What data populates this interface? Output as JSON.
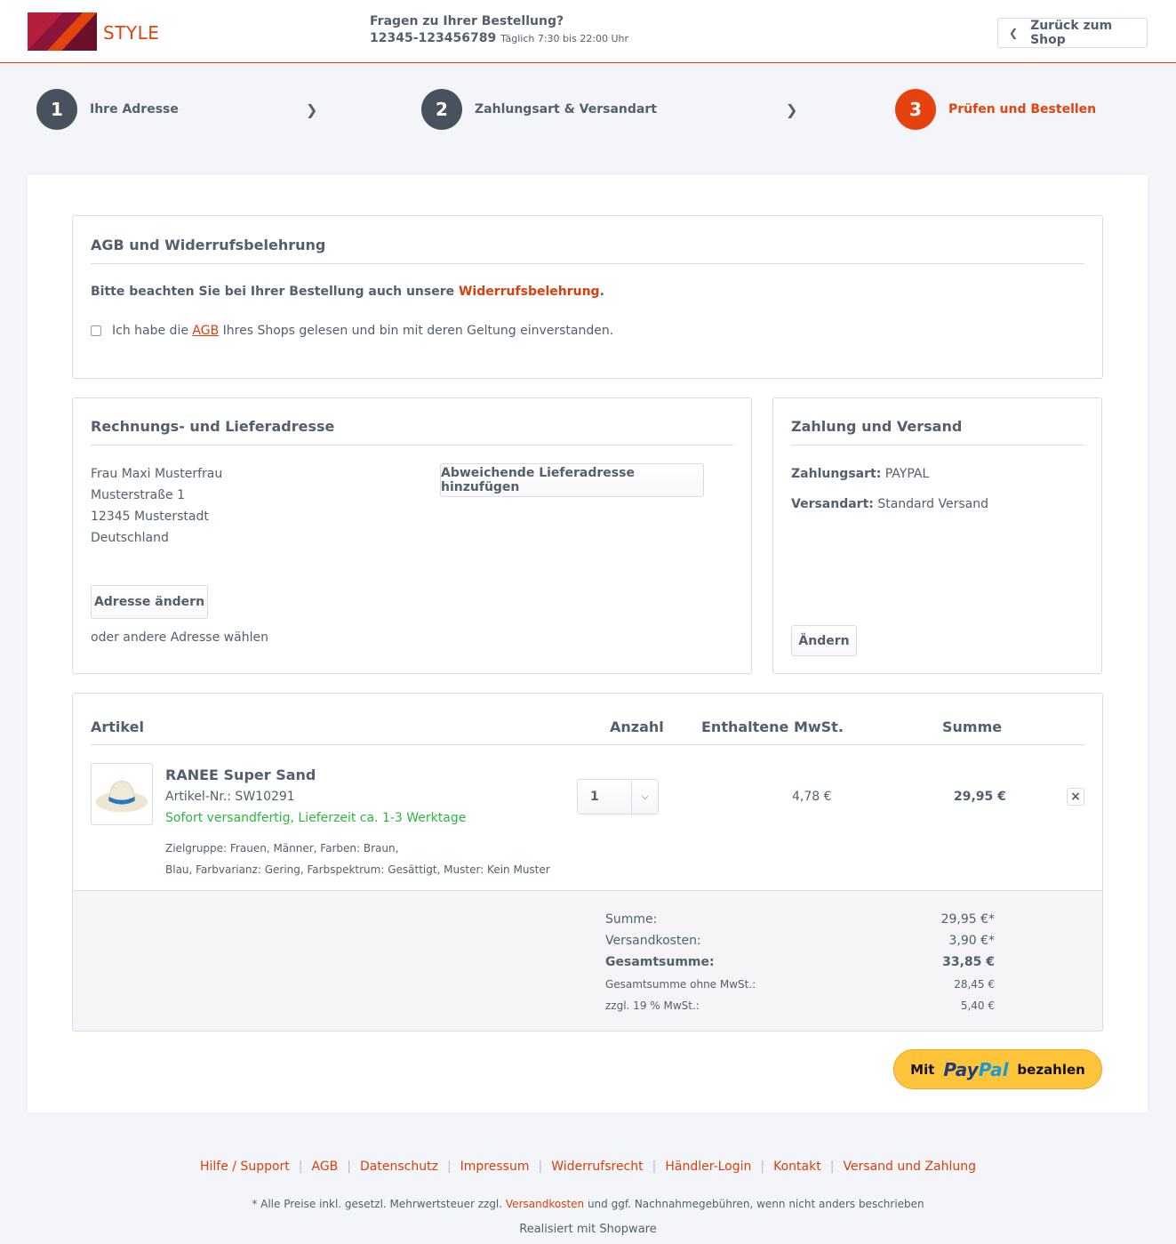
{
  "header": {
    "logo_text": "STYLE",
    "hotline_question": "Fragen zu Ihrer Bestellung?",
    "hotline_number": "12345-123456789",
    "hotline_hours": "Täglich 7:30 bis 22:00 Uhr",
    "back_label": "Zurück zum Shop"
  },
  "steps": [
    {
      "num": "1",
      "label": "Ihre Adresse"
    },
    {
      "num": "2",
      "label": "Zahlungsart & Versandart"
    },
    {
      "num": "3",
      "label": "Prüfen und Bestellen"
    }
  ],
  "agb": {
    "title": "AGB und Widerrufsbelehrung",
    "notice_text": "Bitte beachten Sie bei Ihrer Bestellung auch unsere ",
    "notice_link": "Widerrufsbelehrung",
    "notice_end": ".",
    "checkbox_pre": "Ich habe die ",
    "checkbox_link": "AGB",
    "checkbox_post": " Ihres Shops gelesen und bin mit deren Geltung einverstanden."
  },
  "address": {
    "title": "Rechnungs- und Lieferadresse",
    "lines": [
      "Frau Maxi Musterfrau",
      "Musterstraße 1",
      "12345 Musterstadt",
      "Deutschland"
    ],
    "add_shipping_label": "Abweichende Lieferadresse hinzufügen",
    "change_label": "Adresse ändern",
    "other_label": "oder andere Adresse wählen"
  },
  "payment": {
    "title": "Zahlung und Versand",
    "payment_label": "Zahlungsart:",
    "payment_value": " PAYPAL",
    "shipping_label": "Versandart:",
    "shipping_value": " Standard Versand",
    "change_label": "Ändern"
  },
  "cart": {
    "headers": {
      "article": "Artikel",
      "qty": "Anzahl",
      "vat": "Enthaltene MwSt.",
      "sum": "Summe"
    },
    "item": {
      "name": "RANEE Super Sand",
      "sku": "Artikel-Nr.: SW10291",
      "delivery": "Sofort versandfertig, Lieferzeit ca. 1-3 Werktage",
      "props_1": "Zielgruppe: Frauen, Männer, Farben: Braun,",
      "props_2": "Blau, Farbvarianz: Gering, Farbspektrum: Gesättigt, Muster: Kein Muster",
      "qty": "1",
      "vat": "4,78 €",
      "sum": "29,95 €",
      "remove": "×"
    },
    "totals": [
      {
        "label": "Summe:",
        "value": "29,95 €*"
      },
      {
        "label": "Versandkosten:",
        "value": "3,90 €*"
      },
      {
        "label": "Gesamtsumme:",
        "value": "33,85 €"
      },
      {
        "label": "Gesamtsumme ohne MwSt.:",
        "value": "28,45 €"
      },
      {
        "label": "zzgl. 19 % MwSt.:",
        "value": "5,40 €"
      }
    ]
  },
  "paypal": {
    "pre": "Mit",
    "brand_1": "Pay",
    "brand_2": "Pal",
    "post": "bezahlen"
  },
  "footer": {
    "links": [
      "Hilfe / Support",
      "AGB",
      "Datenschutz",
      "Impressum",
      "Widerrufsrecht",
      "Händler-Login",
      "Kontakt",
      "Versand und Zahlung"
    ],
    "note_pre": "* Alle Preise inkl. gesetzl. Mehrwertsteuer zzgl. ",
    "note_link": "Versandkosten",
    "note_post": " und ggf. Nachnahmegebühren, wenn nicht anders beschrieben",
    "credit": "Realisiert mit Shopware"
  },
  "colors": {
    "accent": "#e5420e",
    "text": "#52606d",
    "success": "#2eb53f",
    "paypal": "#ffc439"
  }
}
